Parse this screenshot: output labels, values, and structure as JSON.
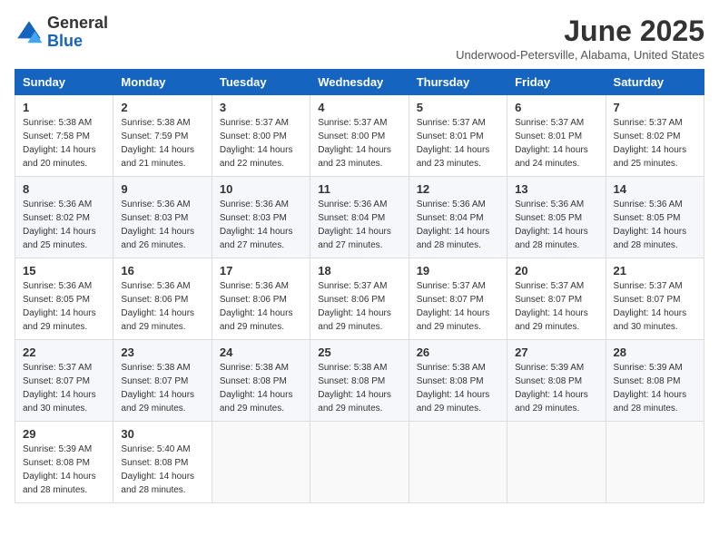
{
  "header": {
    "logo_general": "General",
    "logo_blue": "Blue",
    "month_title": "June 2025",
    "location": "Underwood-Petersville, Alabama, United States"
  },
  "weekdays": [
    "Sunday",
    "Monday",
    "Tuesday",
    "Wednesday",
    "Thursday",
    "Friday",
    "Saturday"
  ],
  "weeks": [
    [
      {
        "day": "1",
        "sunrise": "5:38 AM",
        "sunset": "7:58 PM",
        "daylight": "14 hours and 20 minutes."
      },
      {
        "day": "2",
        "sunrise": "5:38 AM",
        "sunset": "7:59 PM",
        "daylight": "14 hours and 21 minutes."
      },
      {
        "day": "3",
        "sunrise": "5:37 AM",
        "sunset": "8:00 PM",
        "daylight": "14 hours and 22 minutes."
      },
      {
        "day": "4",
        "sunrise": "5:37 AM",
        "sunset": "8:00 PM",
        "daylight": "14 hours and 23 minutes."
      },
      {
        "day": "5",
        "sunrise": "5:37 AM",
        "sunset": "8:01 PM",
        "daylight": "14 hours and 23 minutes."
      },
      {
        "day": "6",
        "sunrise": "5:37 AM",
        "sunset": "8:01 PM",
        "daylight": "14 hours and 24 minutes."
      },
      {
        "day": "7",
        "sunrise": "5:37 AM",
        "sunset": "8:02 PM",
        "daylight": "14 hours and 25 minutes."
      }
    ],
    [
      {
        "day": "8",
        "sunrise": "5:36 AM",
        "sunset": "8:02 PM",
        "daylight": "14 hours and 25 minutes."
      },
      {
        "day": "9",
        "sunrise": "5:36 AM",
        "sunset": "8:03 PM",
        "daylight": "14 hours and 26 minutes."
      },
      {
        "day": "10",
        "sunrise": "5:36 AM",
        "sunset": "8:03 PM",
        "daylight": "14 hours and 27 minutes."
      },
      {
        "day": "11",
        "sunrise": "5:36 AM",
        "sunset": "8:04 PM",
        "daylight": "14 hours and 27 minutes."
      },
      {
        "day": "12",
        "sunrise": "5:36 AM",
        "sunset": "8:04 PM",
        "daylight": "14 hours and 28 minutes."
      },
      {
        "day": "13",
        "sunrise": "5:36 AM",
        "sunset": "8:05 PM",
        "daylight": "14 hours and 28 minutes."
      },
      {
        "day": "14",
        "sunrise": "5:36 AM",
        "sunset": "8:05 PM",
        "daylight": "14 hours and 28 minutes."
      }
    ],
    [
      {
        "day": "15",
        "sunrise": "5:36 AM",
        "sunset": "8:05 PM",
        "daylight": "14 hours and 29 minutes."
      },
      {
        "day": "16",
        "sunrise": "5:36 AM",
        "sunset": "8:06 PM",
        "daylight": "14 hours and 29 minutes."
      },
      {
        "day": "17",
        "sunrise": "5:36 AM",
        "sunset": "8:06 PM",
        "daylight": "14 hours and 29 minutes."
      },
      {
        "day": "18",
        "sunrise": "5:37 AM",
        "sunset": "8:06 PM",
        "daylight": "14 hours and 29 minutes."
      },
      {
        "day": "19",
        "sunrise": "5:37 AM",
        "sunset": "8:07 PM",
        "daylight": "14 hours and 29 minutes."
      },
      {
        "day": "20",
        "sunrise": "5:37 AM",
        "sunset": "8:07 PM",
        "daylight": "14 hours and 29 minutes."
      },
      {
        "day": "21",
        "sunrise": "5:37 AM",
        "sunset": "8:07 PM",
        "daylight": "14 hours and 30 minutes."
      }
    ],
    [
      {
        "day": "22",
        "sunrise": "5:37 AM",
        "sunset": "8:07 PM",
        "daylight": "14 hours and 30 minutes."
      },
      {
        "day": "23",
        "sunrise": "5:38 AM",
        "sunset": "8:07 PM",
        "daylight": "14 hours and 29 minutes."
      },
      {
        "day": "24",
        "sunrise": "5:38 AM",
        "sunset": "8:08 PM",
        "daylight": "14 hours and 29 minutes."
      },
      {
        "day": "25",
        "sunrise": "5:38 AM",
        "sunset": "8:08 PM",
        "daylight": "14 hours and 29 minutes."
      },
      {
        "day": "26",
        "sunrise": "5:38 AM",
        "sunset": "8:08 PM",
        "daylight": "14 hours and 29 minutes."
      },
      {
        "day": "27",
        "sunrise": "5:39 AM",
        "sunset": "8:08 PM",
        "daylight": "14 hours and 29 minutes."
      },
      {
        "day": "28",
        "sunrise": "5:39 AM",
        "sunset": "8:08 PM",
        "daylight": "14 hours and 28 minutes."
      }
    ],
    [
      {
        "day": "29",
        "sunrise": "5:39 AM",
        "sunset": "8:08 PM",
        "daylight": "14 hours and 28 minutes."
      },
      {
        "day": "30",
        "sunrise": "5:40 AM",
        "sunset": "8:08 PM",
        "daylight": "14 hours and 28 minutes."
      },
      null,
      null,
      null,
      null,
      null
    ]
  ]
}
